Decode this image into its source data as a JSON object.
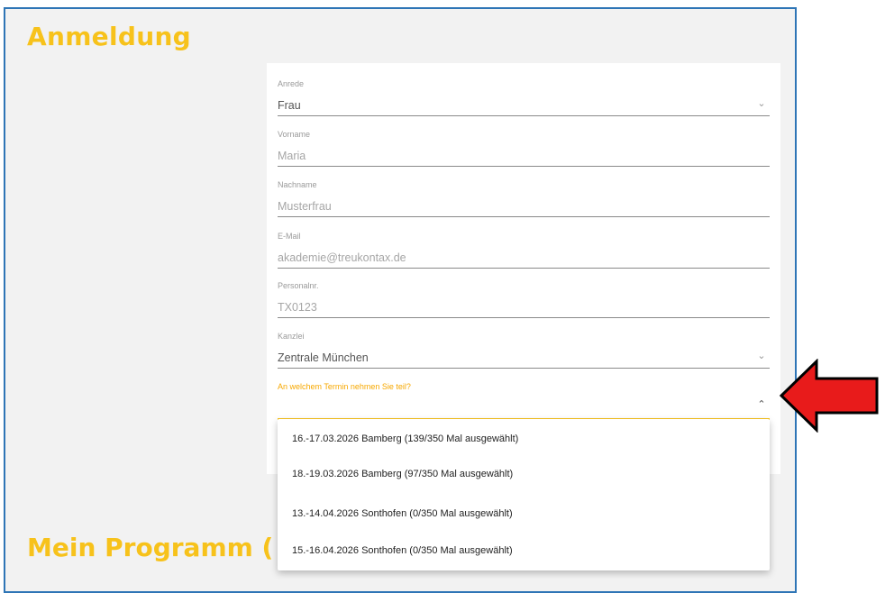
{
  "headings": {
    "main": "Anmeldung",
    "program": "Mein Programm ("
  },
  "fields": [
    {
      "label": "Anrede",
      "value": "Frau",
      "has_chevron": true
    },
    {
      "label": "Vorname",
      "value": "Maria"
    },
    {
      "label": "Nachname",
      "value": "Musterfrau"
    },
    {
      "label": "E-Mail",
      "value": "akademie@treukontax.de"
    },
    {
      "label": "Personalnr.",
      "value": "TX0123"
    },
    {
      "label": "Kanzlei",
      "value": "Zentrale München",
      "has_chevron": true
    },
    {
      "label": "An welchem Termin nehmen Sie teil?",
      "value": "",
      "has_chevron": true,
      "focused": true
    }
  ],
  "dropdown": {
    "options": [
      "16.-17.03.2026 Bamberg (139/350 Mal ausgewählt)",
      "18.-19.03.2026 Bamberg (97/350 Mal ausgewählt)",
      "13.-14.04.2026 Sonthofen (0/350 Mal ausgewählt)",
      "15.-16.04.2026 Sonthofen (0/350 Mal ausgewählt)"
    ]
  },
  "icons": {
    "chevron_down": "chevron-down-icon",
    "chevron_up": "chevron-up-icon",
    "pointer": "red-arrow-icon"
  },
  "colors": {
    "accent": "#f7c21b",
    "panel_border": "#2e75b6",
    "arrow_fill": "#e81b1b"
  }
}
